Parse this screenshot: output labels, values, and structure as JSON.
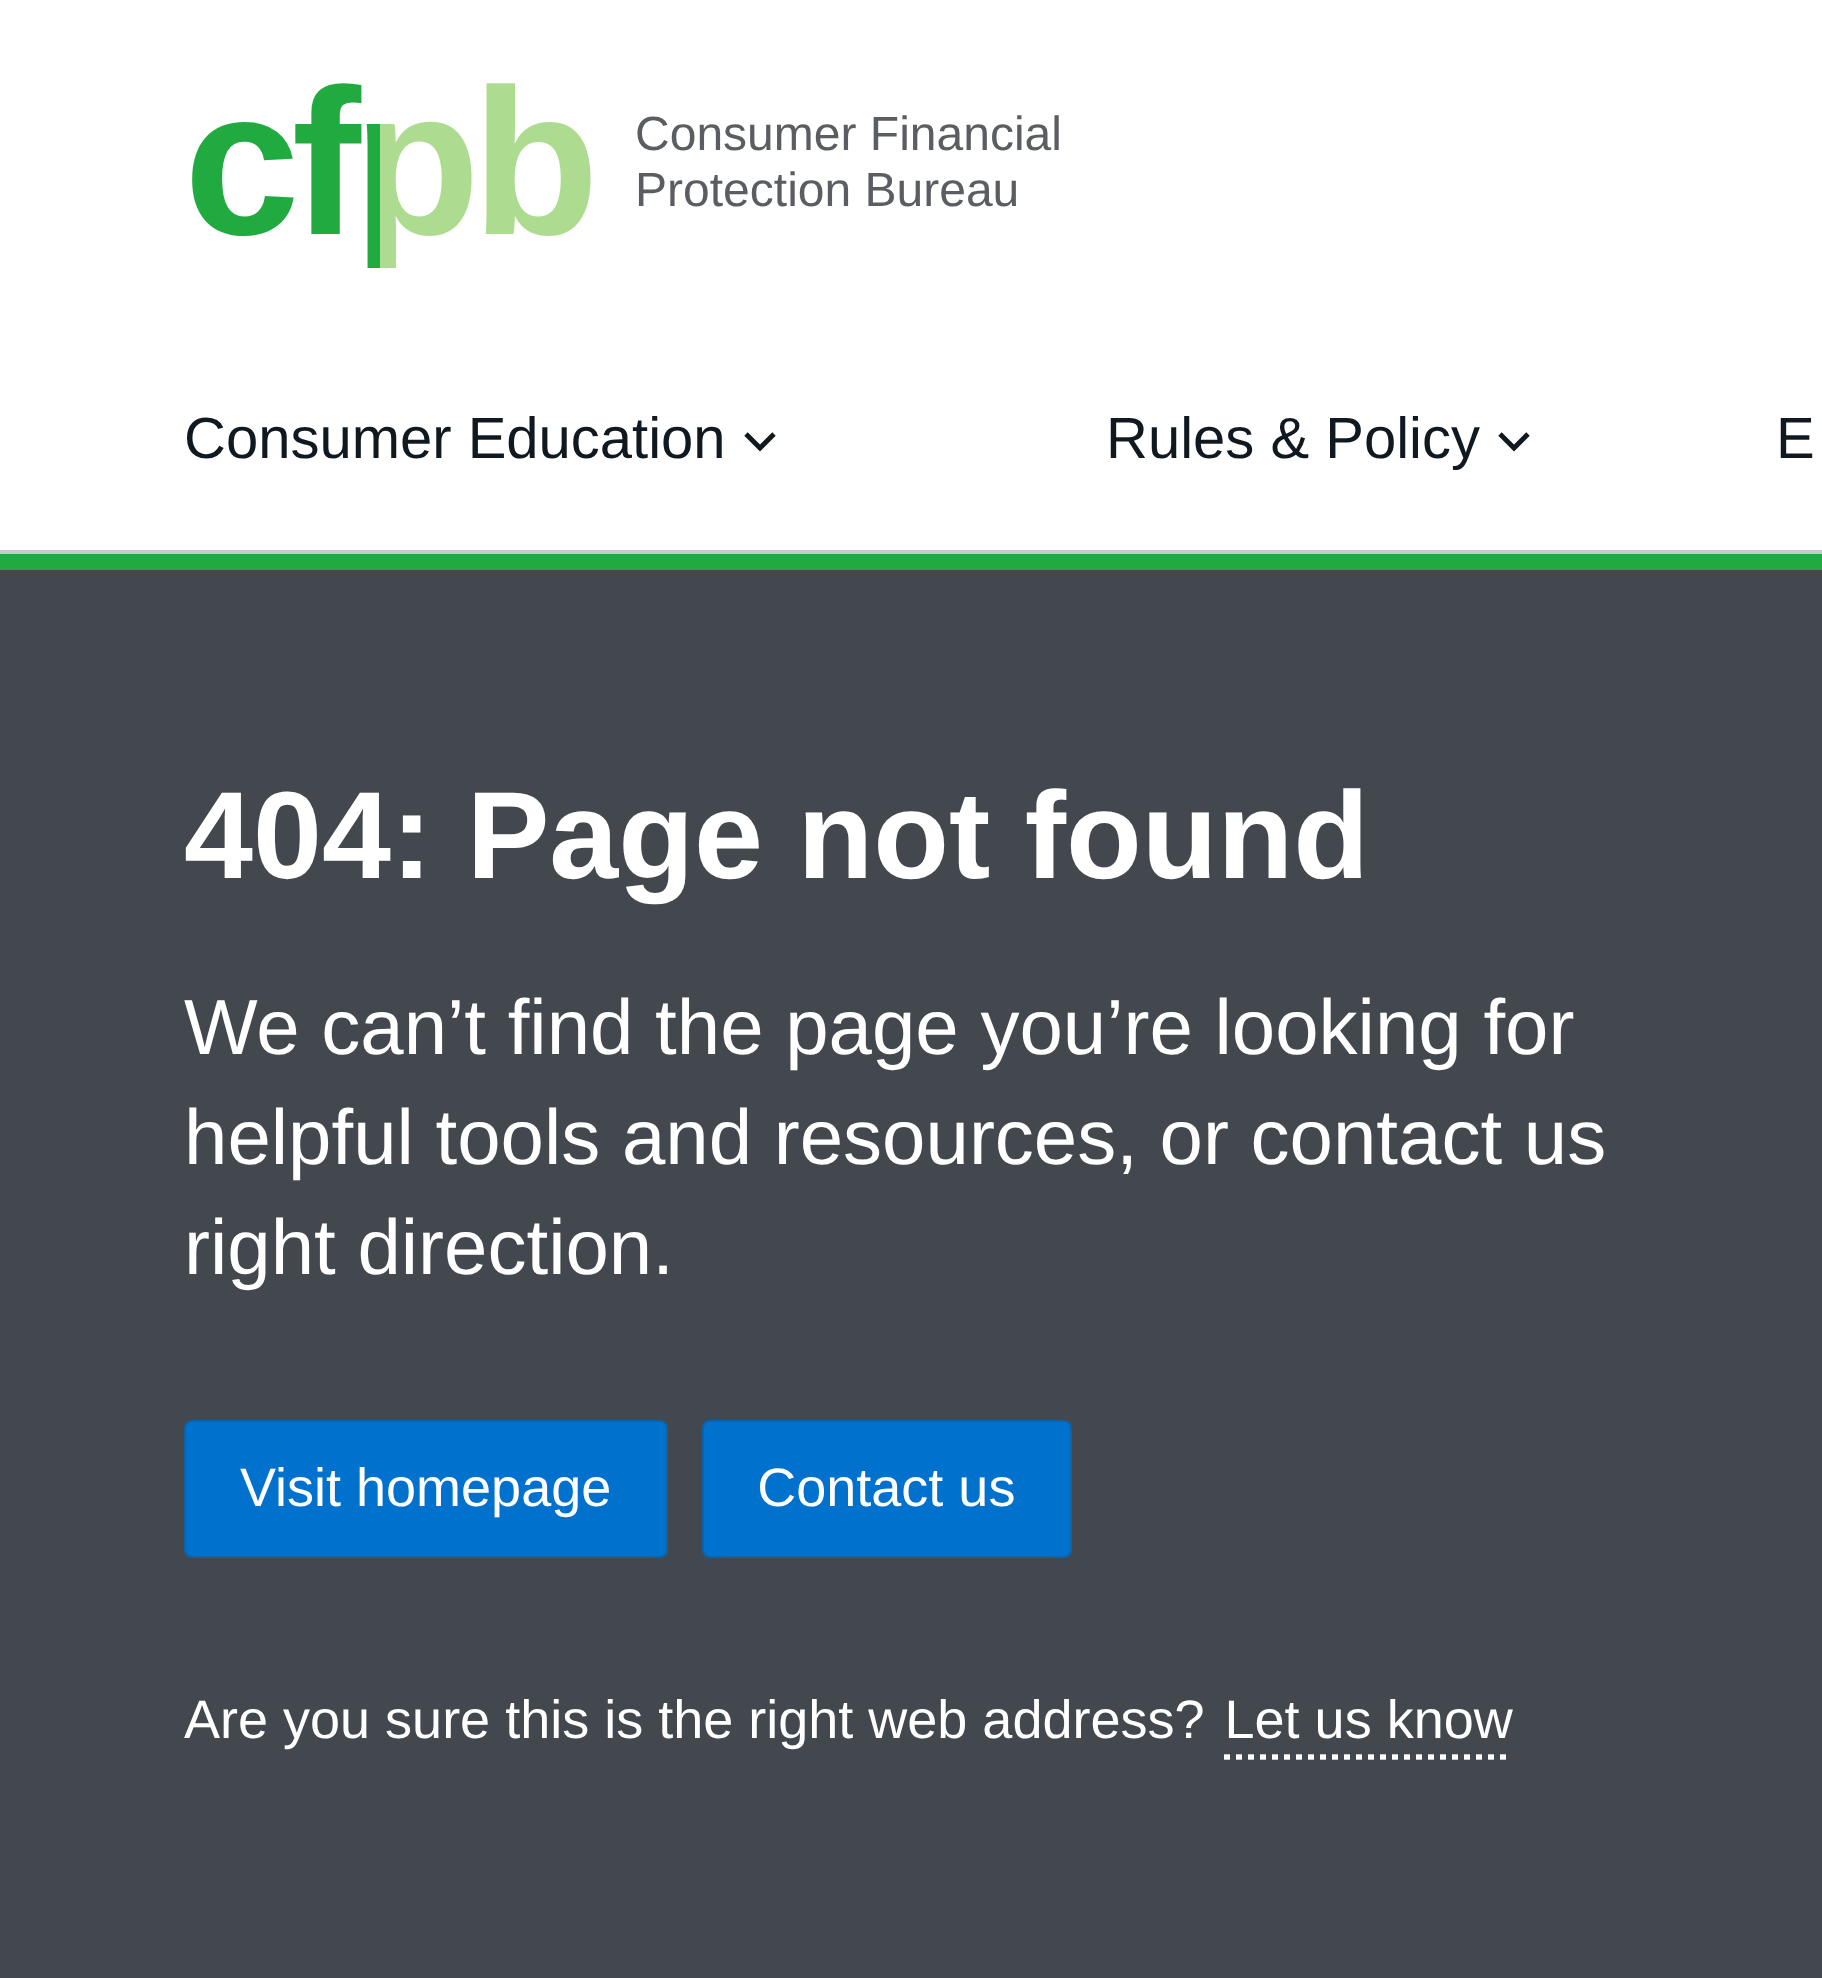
{
  "logo": {
    "mark": "cfpb",
    "name_lines": [
      "Consumer Financial",
      "Protection Bureau"
    ]
  },
  "nav": [
    {
      "label": "Consumer Education",
      "has_menu": true
    },
    {
      "label": "Rules & Policy",
      "has_menu": true
    },
    {
      "label": "E"
    }
  ],
  "error": {
    "title": "404: Page not found",
    "message_lines": [
      "We can’t find the page you’re looking for",
      "helpful tools and resources, or contact us",
      "right direction."
    ]
  },
  "buttons": [
    "Visit homepage",
    "Contact us"
  ],
  "footer": {
    "question": "Are you sure this is the right web address?",
    "link": "Let us know"
  }
}
